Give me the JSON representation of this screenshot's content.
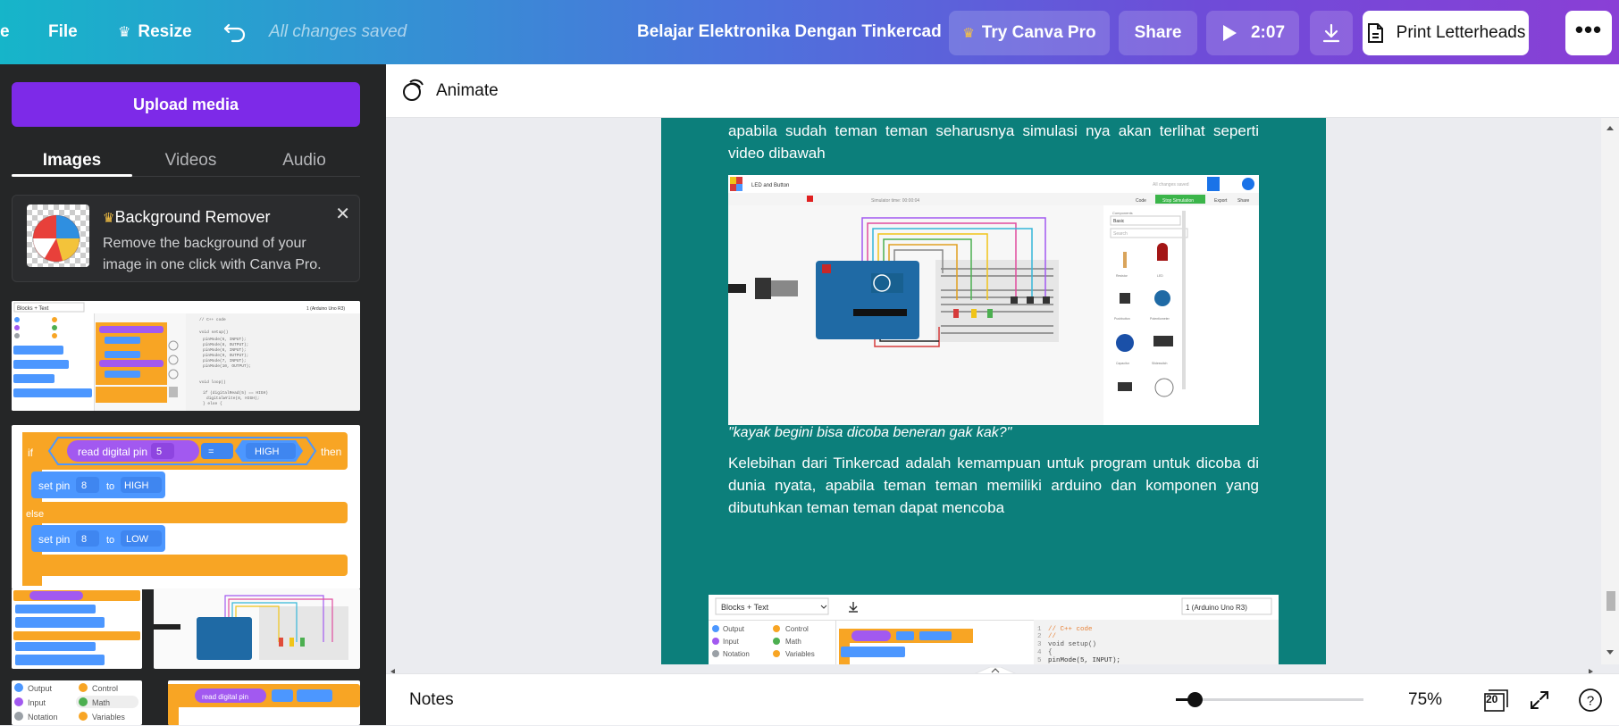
{
  "topbar": {
    "home_partial": "e",
    "file_label": "File",
    "resize_label": "Resize",
    "saved_status": "All changes saved",
    "doc_title": "Belajar Elektronika Dengan Tinkercad",
    "try_pro_label": "Try Canva Pro",
    "share_label": "Share",
    "present_time": "2:07",
    "print_label": "Print Letterheads"
  },
  "leftpanel": {
    "upload_label": "Upload media",
    "tabs": [
      {
        "label": "Images"
      },
      {
        "label": "Videos"
      },
      {
        "label": "Audio"
      }
    ],
    "active_tab": "Images",
    "bg_remover": {
      "title": "Background Remover",
      "desc": "Remove the background of your image in one click with Canva Pro."
    },
    "thumb_text": {
      "blocks_text": "Blocks + Text",
      "arduino": "1 (Arduino Uno R3)",
      "read_digital_pin": "read digital pin",
      "pin5": "5",
      "eq": "=",
      "high": "HIGH",
      "then": "then",
      "if_text": "if",
      "set_pin": "set pin",
      "pin8": "8",
      "to": "to",
      "low": "LOW",
      "else_text": "else",
      "output": "Output",
      "control": "Control",
      "input": "Input",
      "math": "Math",
      "notation": "Notation",
      "variables": "Variables"
    }
  },
  "editor": {
    "animate_label": "Animate",
    "para1": "apabila sudah teman teman seharusnya simulasi nya akan terlihat seperti video dibawah",
    "quote": "\"kayak begini bisa dicoba beneran gak kak?\"",
    "para2": "Kelebihan dari Tinkercad adalah kemampuan untuk program untuk dicoba di dunia nyata, apabila teman teman memiliki arduino dan komponen yang dibutuhkan teman teman dapat mencoba",
    "sim_title": "LED and Button",
    "sim_saved": "All changes saved",
    "sim_timer": "Simulator time: 00:00:04",
    "sim_code": "Code",
    "sim_stop": "Stop Simulation",
    "sim_export": "Export",
    "sim_share": "Share",
    "sim_components": "Components",
    "sim_basic": "Basic",
    "sim_search": "Search",
    "sim_parts": [
      "Resistor",
      "LED",
      "Pushbutton",
      "Potentiometer",
      "Capacitor",
      "Slideswitch"
    ],
    "code_lines": [
      "// C++ code",
      "//",
      "void setup()",
      "{",
      "  pinMode(5, INPUT);"
    ]
  },
  "bottombar": {
    "notes_label": "Notes",
    "zoom_value": "75%",
    "zoom_fraction": 0.1,
    "page_count": "20",
    "help": "?"
  },
  "colors": {
    "purple": "#7d2ae8",
    "teal_page": "#0c7f7b",
    "block_orange": "#f8a524",
    "block_purple": "#a259f0",
    "block_blue": "#4c97ff"
  }
}
